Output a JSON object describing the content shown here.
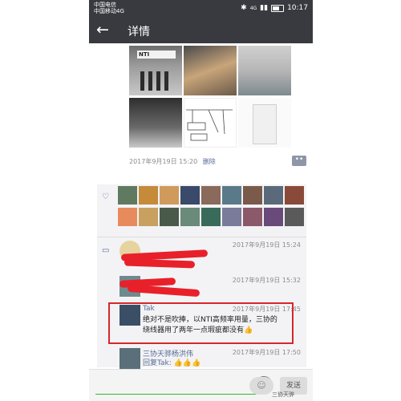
{
  "status_bar": {
    "carrier_1": "中国电信",
    "carrier_2": "中国移动4G",
    "signal": "4G",
    "time": "10:17"
  },
  "header": {
    "back_icon": "back-arrow-icon",
    "title": "详情"
  },
  "post": {
    "photos": [
      {
        "caption": "NTI"
      },
      {
        "caption": ""
      },
      {
        "caption": ""
      },
      {
        "caption": ""
      },
      {
        "caption": ""
      },
      {
        "caption": ""
      }
    ],
    "time": "2017年9月19日 15:20",
    "delete_label": "删除",
    "more_icon": "more-dots-icon"
  },
  "likes": {
    "icon": "heart-icon",
    "avatar_colors": [
      "#5f7a60",
      "#c58a3a",
      "#d09a5c",
      "#3a4a6a",
      "#8a6a5a",
      "#5a7a8a",
      "#7a5a4a",
      "#5a6a7a",
      "#8a4a3a",
      "#e88b5c",
      "#c8a060",
      "#4a5a4a",
      "#6a8a7a",
      "#3a6a5a",
      "#7a7a9a",
      "#8a5a6a",
      "#6a4a7a",
      "#5a5a5a"
    ]
  },
  "comments": {
    "icon": "comment-icon",
    "items": [
      {
        "name": "",
        "time": "2017年9月19日 15:24",
        "text": ""
      },
      {
        "name": "",
        "time": "2017年9月19日 15:32",
        "text": ""
      },
      {
        "name": "Tak",
        "time": "2017年9月19日 17:45",
        "text": "绝对不是吹捧，以NTI高频率用量，三协的绕线器用了两年一点瑕疵都没有👍"
      },
      {
        "name": "三协天骅杨洪伟",
        "time": "2017年9月19日 17:50",
        "text": "回复Tak: 👍👍👍"
      }
    ]
  },
  "footer": {
    "emoji_icon": "smiley-icon",
    "send_label": "发送"
  },
  "watermark": {
    "text": "三协天骅"
  },
  "colors": {
    "topbar": "#393a3f",
    "link": "#576b95",
    "highlight": "#d6262b",
    "redaction": "#e8202a"
  }
}
